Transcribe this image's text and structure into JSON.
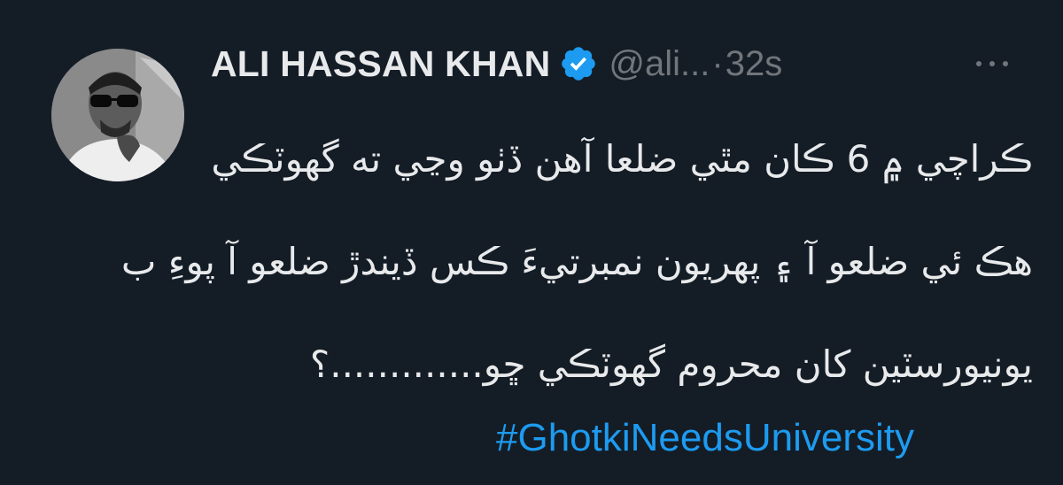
{
  "tweet": {
    "author_name": "ALI HASSAN KHAN",
    "handle": "@ali...",
    "separator": "·",
    "time": "32s",
    "lines": [
      "ڪراچي ۾ 6 ڪان مٿي ضلعا آهن ڏٺو وڃي ته گهوٽڪي",
      "هڪ ئي ضلعو آ ۽ پهريون نمبرتيءَ ڪس ڏيندڙ ضلعو آ پوءِ ب",
      "يونيورسٽين کان محروم گهوٽڪي ڇو.............؟"
    ],
    "hashtag": "#GhotkiNeedsUniversity"
  },
  "colors": {
    "background": "#141c26",
    "text": "#e7e9ea",
    "secondary": "#71767b",
    "accent": "#1d9bf0"
  },
  "icons": {
    "verified": "verified-badge-icon",
    "more": "more-options-icon"
  }
}
